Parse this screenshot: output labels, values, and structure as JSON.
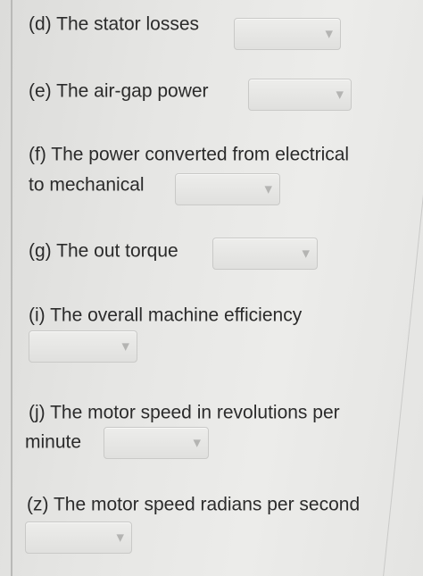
{
  "questions": [
    {
      "label": "(d) The stator losses",
      "selected_value": ""
    },
    {
      "label": "(e) The air-gap power",
      "selected_value": ""
    },
    {
      "label_line1": "(f) The power converted from electrical",
      "label_line2": "to mechanical",
      "selected_value": ""
    },
    {
      "label": "(g) The out torque",
      "selected_value": ""
    },
    {
      "label": "(i) The overall machine efficiency",
      "selected_value": ""
    },
    {
      "label_line1": "(j) The motor speed in revolutions per",
      "label_line2": "minute",
      "selected_value": ""
    },
    {
      "label": "(z) The motor speed radians per second",
      "selected_value": ""
    }
  ],
  "dropdown_caret_icon": "chevron-down-icon"
}
